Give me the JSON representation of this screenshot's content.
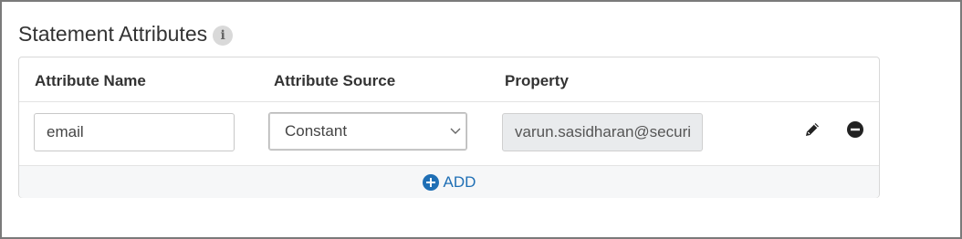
{
  "section": {
    "title": "Statement Attributes",
    "info_glyph": "i"
  },
  "table": {
    "columns": [
      "Attribute Name",
      "Attribute Source",
      "Property"
    ],
    "rows": [
      {
        "attribute_name": "email",
        "attribute_source": "Constant",
        "property": "varun.sasidharan@securi"
      }
    ]
  },
  "actions": {
    "add_label": "ADD",
    "edit_icon": "pencil-icon",
    "remove_icon": "minus-circle-icon"
  },
  "colors": {
    "accent": "#1f6fb5",
    "readonly_bg": "#e9ebed",
    "border": "#d8d8d8"
  }
}
